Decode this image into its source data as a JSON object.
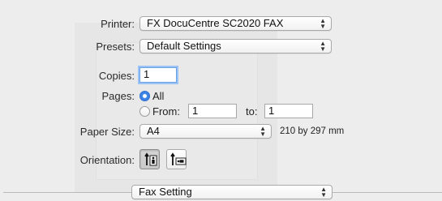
{
  "printer": {
    "label": "Printer:",
    "value": "FX DocuCentre SC2020 FAX"
  },
  "presets": {
    "label": "Presets:",
    "value": "Default Settings"
  },
  "copies": {
    "label": "Copies:",
    "value": "1"
  },
  "pages": {
    "label": "Pages:",
    "all_label": "All",
    "from_label": "From:",
    "from_value": "1",
    "to_label": "to:",
    "to_value": "1",
    "selected": "All"
  },
  "paper_size": {
    "label": "Paper Size:",
    "value": "A4",
    "dimensions": "210 by 297 mm"
  },
  "orientation": {
    "label": "Orientation:",
    "selected": "portrait"
  },
  "section_menu": {
    "value": "Fax Setting"
  },
  "icons": {
    "popup_arrows": "up-down-chevron-icon",
    "portrait": "portrait-orientation-icon",
    "landscape": "landscape-orientation-icon"
  },
  "colors": {
    "accent": "#3a82e6",
    "focus_ring": "#9cc3f5",
    "background": "#ededed"
  }
}
